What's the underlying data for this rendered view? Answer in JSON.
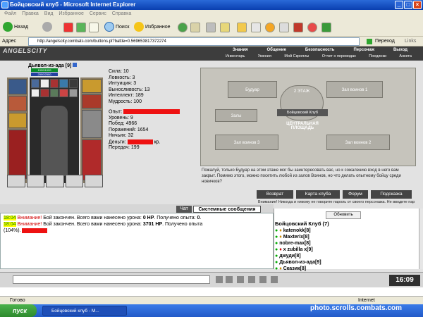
{
  "window": {
    "title": "Бойцовский клуб - Microsoft Internet Explorer"
  },
  "menu": [
    "Файл",
    "Правка",
    "Вид",
    "Избранное",
    "Сервис",
    "Справка"
  ],
  "toolbar": {
    "back_label": "Назад",
    "search_label": "Поиск",
    "favorites_label": "Избранное"
  },
  "address": {
    "label": "Адрес",
    "url": "http://angelscity.combats.com/buttons.pl?battle=0.569653817372274",
    "go_label": "Переход",
    "links_label": "Links"
  },
  "game": {
    "logo": "ANGELSCITY",
    "nav_top": [
      "Знания",
      "Общение",
      "Безопасность",
      "Персонаж",
      "Выход"
    ],
    "nav_bottom": [
      "Инвентарь",
      "Умения",
      "Мой Скроллы",
      "Отчет о переводах",
      "Поединки",
      "Анкета"
    ]
  },
  "character": {
    "nick": "Дьявол-из-ада [9]",
    "hp": "1020/1020",
    "mana": "2500/2500",
    "stats": [
      "Сила: 10",
      "Ловкость: 3",
      "Интуиция: 3",
      "Выносливость: 13",
      "Интеллект: 189",
      "Мудрость: 100"
    ],
    "exp_label": "Опыт:",
    "records": [
      "Уровень: 9",
      "Побед: 4966",
      "Поражений: 1654",
      "Ничьих: 32"
    ],
    "money_label": "Деньги:",
    "money_unit": "кр.",
    "transfers": "Передач: 199"
  },
  "map": {
    "floor": "2 ЭТАЖ",
    "club": "Бойцовский Клуб",
    "square": "ЦЕНТРАЛЬНАЯ ПЛОЩАДЬ",
    "rooms": [
      "Будуар",
      "Зал воинов 1",
      "Залы",
      "Зал воинов 3",
      "Зал воинов 2"
    ]
  },
  "description": "Пожалуй, только Будуар на этом этаже мог бы заинтересовать вас, но к сожалению вход в него вам закрыт. Помимо этого, можно посетить любой из залов Воинов, но что делать опытному бойцу среди новичков?",
  "buttons": [
    "Возврат",
    "Карта клуба",
    "Форум",
    "Подсказка"
  ],
  "warning": "Внимание! Никогда и никому не говорите пароль от своего персонажа. Не вводите пароль на",
  "tabs": {
    "chat": "Чат",
    "system": "Системные сообщения"
  },
  "chat": [
    {
      "time": "18:04",
      "attn": "Внимание!",
      "text": "Бой закончен. Всего вами нанесено урона: ",
      "dmg": "0 HP",
      "rest": ". Получено опыта: ",
      "exp": "0",
      "tail": "."
    },
    {
      "time": "18:04",
      "attn": "Внимание!",
      "text": "Бой закончен. Всего вами нанесено урона: ",
      "dmg": "3701 HP",
      "rest": ". Получено опыта ",
      "exp": "",
      "tail": ""
    }
  ],
  "chat_tail": "(104%).",
  "refresh_label": "Обновить",
  "clan_title": "Бойцовский Клуб (7)",
  "players": [
    "katenokk[8]",
    "Maxterix[8]",
    "nobre-max[8]",
    "x zubilla x[9]",
    "джуди[8]",
    "Дьявол-из-ада[9]",
    "Сказик[8]"
  ],
  "clock": "16:09",
  "status": {
    "ready": "Готово",
    "zone": "Internet"
  },
  "taskbar": {
    "start": "пуск",
    "item": "Бойцовский клуб - M..."
  },
  "watermark": "photo.scrolls.combats.com"
}
